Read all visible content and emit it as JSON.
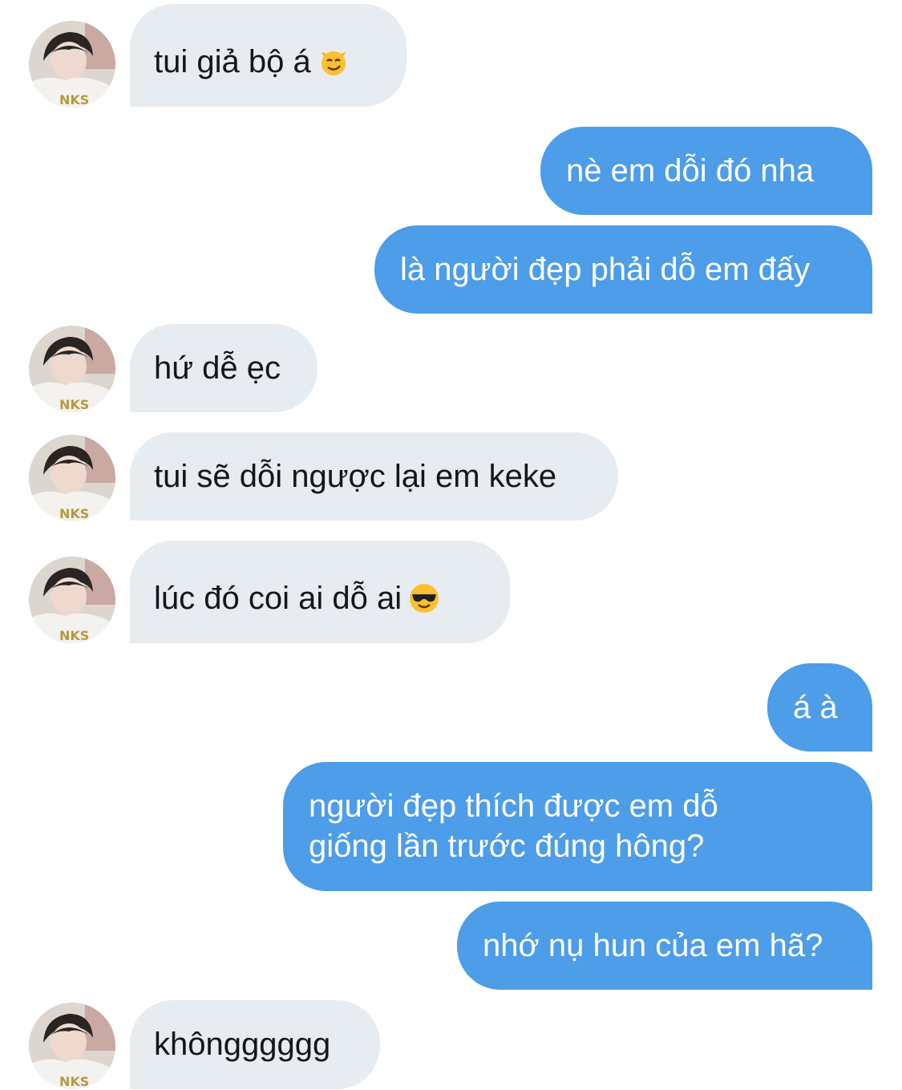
{
  "colors": {
    "incoming_bubble": "#e6ecf0",
    "outgoing_bubble": "#4d9de8",
    "incoming_text": "#14171a",
    "outgoing_text": "#ffffff"
  },
  "contact": {
    "avatar_icon": "profile-photo-avatar"
  },
  "messages": [
    {
      "direction": "incoming",
      "text": "tui giả bộ á",
      "emoji": "smirking-cat-face-emoji"
    },
    {
      "direction": "outgoing",
      "text": "nè em dỗi đó nha"
    },
    {
      "direction": "outgoing",
      "text": "là người đẹp phải dỗ em đấy"
    },
    {
      "direction": "incoming",
      "text": "hứ dễ ẹc"
    },
    {
      "direction": "incoming",
      "text": "tui sẽ dỗi ngược lại em keke"
    },
    {
      "direction": "incoming",
      "text": "lúc đó coi ai dỗ ai",
      "emoji": "smiling-face-with-sunglasses-emoji"
    },
    {
      "direction": "outgoing",
      "text": "á à"
    },
    {
      "direction": "outgoing",
      "lines": [
        "người đẹp thích được em dỗ",
        "giống lần trước đúng hông?"
      ]
    },
    {
      "direction": "outgoing",
      "text": "nhớ nụ hun của em hã?"
    },
    {
      "direction": "incoming",
      "text": "khôngggggg"
    }
  ]
}
